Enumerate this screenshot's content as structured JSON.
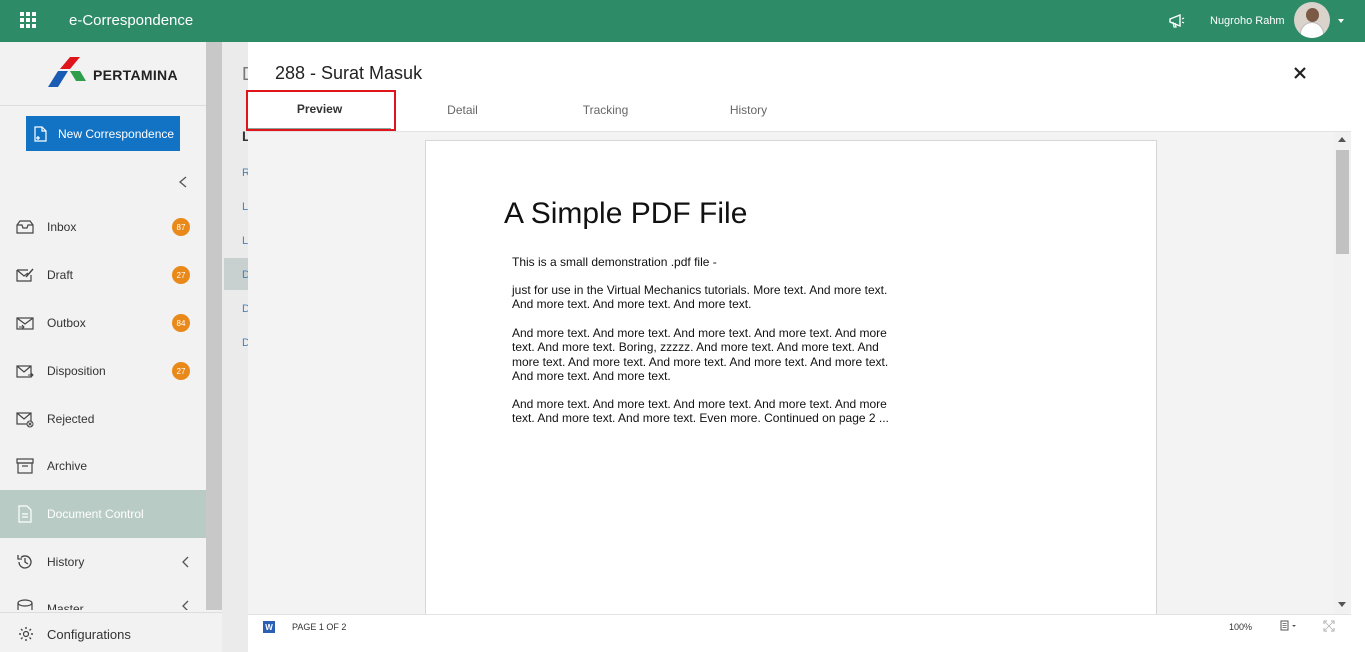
{
  "header": {
    "app_title": "e-Correspondence",
    "user_name": "Nugroho Rahm"
  },
  "brand": {
    "logo_text": "PERTAMINA"
  },
  "sidebar": {
    "new_button_label": "New Correspondence",
    "items": [
      {
        "label": "Inbox",
        "badge": "87",
        "icon": "inbox-icon"
      },
      {
        "label": "Draft",
        "badge": "27",
        "icon": "draft-icon"
      },
      {
        "label": "Outbox",
        "badge": "84",
        "icon": "outbox-icon"
      },
      {
        "label": "Disposition",
        "badge": "27",
        "icon": "disposition-icon"
      },
      {
        "label": "Rejected",
        "badge": "",
        "icon": "rejected-icon"
      },
      {
        "label": "Archive",
        "badge": "",
        "icon": "archive-icon"
      },
      {
        "label": "Document Control",
        "badge": "",
        "icon": "document-control-icon",
        "active": true
      },
      {
        "label": "History",
        "badge": "",
        "icon": "history-icon"
      },
      {
        "label": "Master",
        "badge": "",
        "icon": "master-icon"
      }
    ],
    "config_label": "Configurations"
  },
  "background_list": {
    "letters": [
      "D",
      "L",
      "R",
      "L",
      "L",
      "D",
      "D",
      "D"
    ]
  },
  "modal": {
    "title": "288 - Surat Masuk",
    "tabs": [
      "Preview",
      "Detail",
      "Tracking",
      "History"
    ],
    "active_tab": "Preview"
  },
  "document": {
    "heading": "A Simple PDF File",
    "paragraphs": [
      "This is a small demonstration .pdf file -",
      "just for use in the Virtual Mechanics tutorials. More text. And more text. And more text. And more text. And more text.",
      "And more text. And more text. And more text. And more text. And more text. And more text. Boring, zzzzz. And more text. And more text. And more text. And more text. And more text. And more text. And more text. And more text. And more text.",
      "And more text. And more text. And more text. And more text. And more text. And more text. And more text. Even more. Continued on page 2 ..."
    ]
  },
  "viewer": {
    "page_indicator": "PAGE 1 OF 2",
    "zoom": "100%",
    "word_icon_letter": "W"
  },
  "colors": {
    "topbar": "#2e8b68",
    "primary_button": "#1272c4",
    "badge": "#e8891a",
    "highlight_border": "#e0141b"
  }
}
